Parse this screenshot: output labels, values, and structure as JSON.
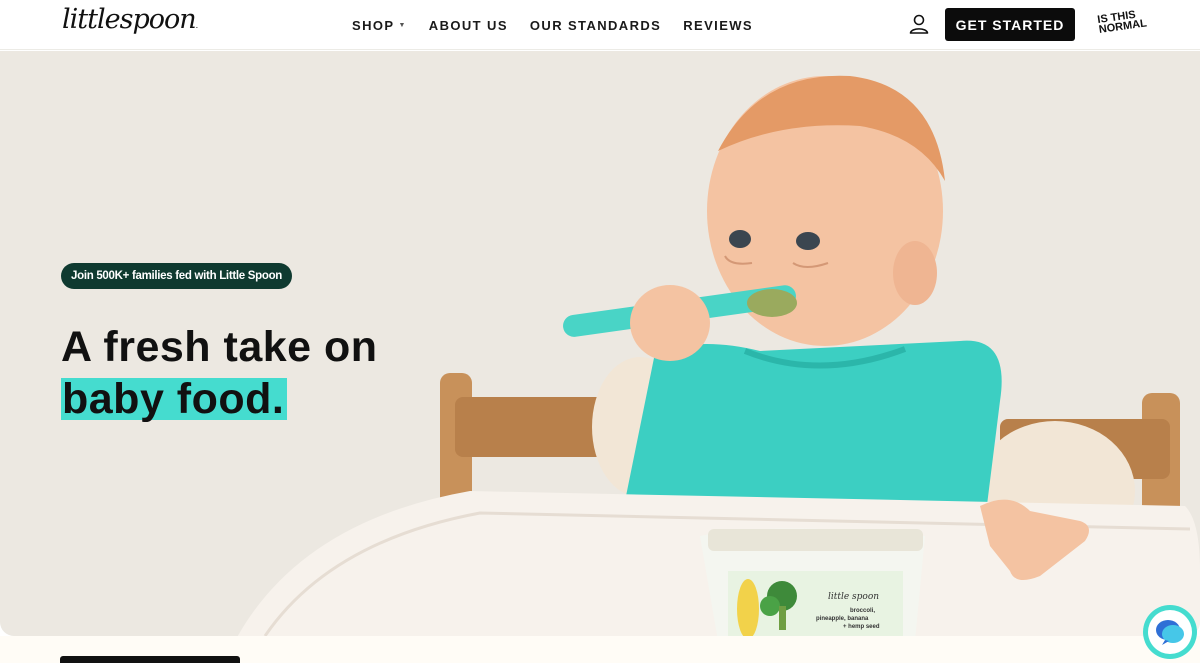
{
  "brand": {
    "logo_text": "littlespoon",
    "logo_mark": "."
  },
  "nav": {
    "items": [
      {
        "label": "SHOP",
        "has_dropdown": true
      },
      {
        "label": "ABOUT US",
        "has_dropdown": false
      },
      {
        "label": "OUR STANDARDS",
        "has_dropdown": false
      },
      {
        "label": "REVIEWS",
        "has_dropdown": false
      }
    ],
    "account_icon": "user-icon",
    "cta_label": "GET STARTED",
    "partner_logo": [
      "IS THIS",
      "NORMAL"
    ]
  },
  "hero": {
    "badge": "Join 500K+ families fed with Little Spoon",
    "headline_line1": "A fresh take on",
    "headline_line2": "baby food.",
    "image": "baby-eating-with-spoon-photo",
    "product": {
      "brand": "little spoon",
      "label_line1": "broccoli,",
      "label_line2": "pineapple, banana",
      "label_line3": "+ hemp seed"
    }
  },
  "chat": {
    "icon": "chat-icon"
  },
  "colors": {
    "accent": "#45dccf",
    "badge_bg": "#0f3a30",
    "hero_bg": "#ece8e1",
    "cta_bg": "#0c0c0c"
  }
}
